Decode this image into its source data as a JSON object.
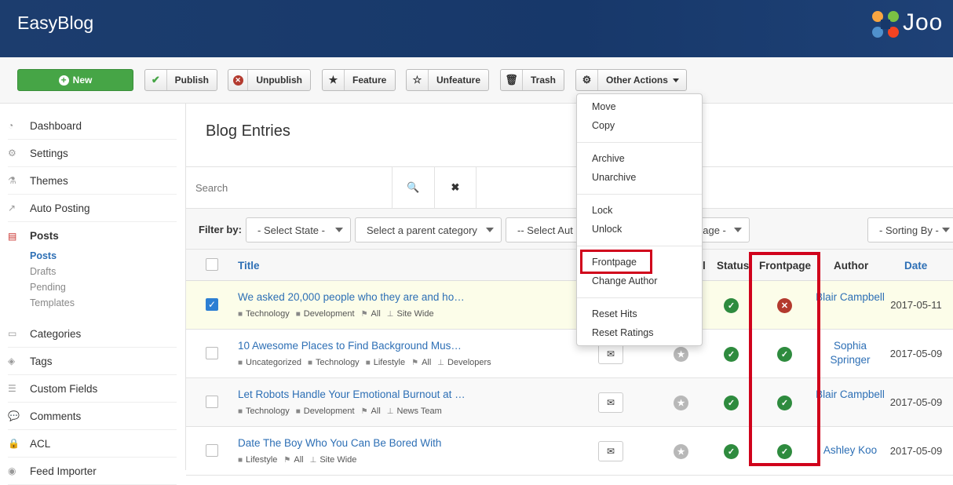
{
  "app": {
    "title": "EasyBlog",
    "joomla_text": "Joo"
  },
  "toolbar": {
    "new": "New",
    "publish": "Publish",
    "unpublish": "Unpublish",
    "feature": "Feature",
    "unfeature": "Unfeature",
    "trash": "Trash",
    "other_actions": "Other Actions"
  },
  "dropdown": {
    "items": [
      "Move",
      "Copy",
      "Archive",
      "Unarchive",
      "Lock",
      "Unlock",
      "Frontpage",
      "Change Author",
      "Reset Hits",
      "Reset Ratings"
    ]
  },
  "sidebar": {
    "items": [
      {
        "label": "Dashboard",
        "icon": "dashboard-icon"
      },
      {
        "label": "Settings",
        "icon": "gear-icon"
      },
      {
        "label": "Themes",
        "icon": "flask-icon"
      },
      {
        "label": "Auto Posting",
        "icon": "share-icon"
      },
      {
        "label": "Posts",
        "icon": "document-icon"
      },
      {
        "label": "Categories",
        "icon": "archive-icon"
      },
      {
        "label": "Tags",
        "icon": "tags-icon"
      },
      {
        "label": "Custom Fields",
        "icon": "list-icon"
      },
      {
        "label": "Comments",
        "icon": "comments-icon"
      },
      {
        "label": "ACL",
        "icon": "lock-icon"
      },
      {
        "label": "Feed Importer",
        "icon": "rss-icon"
      }
    ],
    "posts_sub": [
      "Posts",
      "Drafts",
      "Pending",
      "Templates"
    ]
  },
  "main": {
    "title": "Blog Entries",
    "search_placeholder": "Search",
    "filter_label": "Filter by:",
    "filters": [
      "- Select State -",
      "Select a parent category",
      "-- Select Aut",
      "uage -",
      "- Sorting By -"
    ],
    "columns": {
      "title": "Title",
      "status": "Status",
      "frontpage": "Frontpage",
      "author": "Author",
      "date": "Date",
      "partial": "l"
    }
  },
  "entries": [
    {
      "title": "We asked 20,000 people who they are and ho…",
      "tags": [
        "Technology",
        "Development",
        "All",
        "Site Wide"
      ],
      "author": "Blair Campbell",
      "date": "2017-05-11",
      "status": "ok",
      "frontpage": "no",
      "checked": true
    },
    {
      "title": "10 Awesome Places to Find Background Mus…",
      "tags": [
        "Uncategorized",
        "Technology",
        "Lifestyle",
        "All",
        "Developers"
      ],
      "author": "Sophia Springer",
      "date": "2017-05-09",
      "status": "ok",
      "frontpage": "ok",
      "checked": false
    },
    {
      "title": "Let Robots Handle Your Emotional Burnout at …",
      "tags": [
        "Technology",
        "Development",
        "All",
        "News Team"
      ],
      "author": "Blair Campbell",
      "date": "2017-05-09",
      "status": "ok",
      "frontpage": "ok",
      "checked": false
    },
    {
      "title": "Date The Boy Who You Can Be Bored With",
      "tags": [
        "Lifestyle",
        "All",
        "Site Wide"
      ],
      "author": "Ashley Koo",
      "date": "2017-05-09",
      "status": "ok",
      "frontpage": "ok",
      "checked": false
    }
  ],
  "colors": {
    "header": "#1c3d6e",
    "new_button": "#46a546",
    "link": "#2d6fb5",
    "highlight": "#d0021b",
    "ok": "#2e8b3e",
    "error": "#b33a2e"
  }
}
